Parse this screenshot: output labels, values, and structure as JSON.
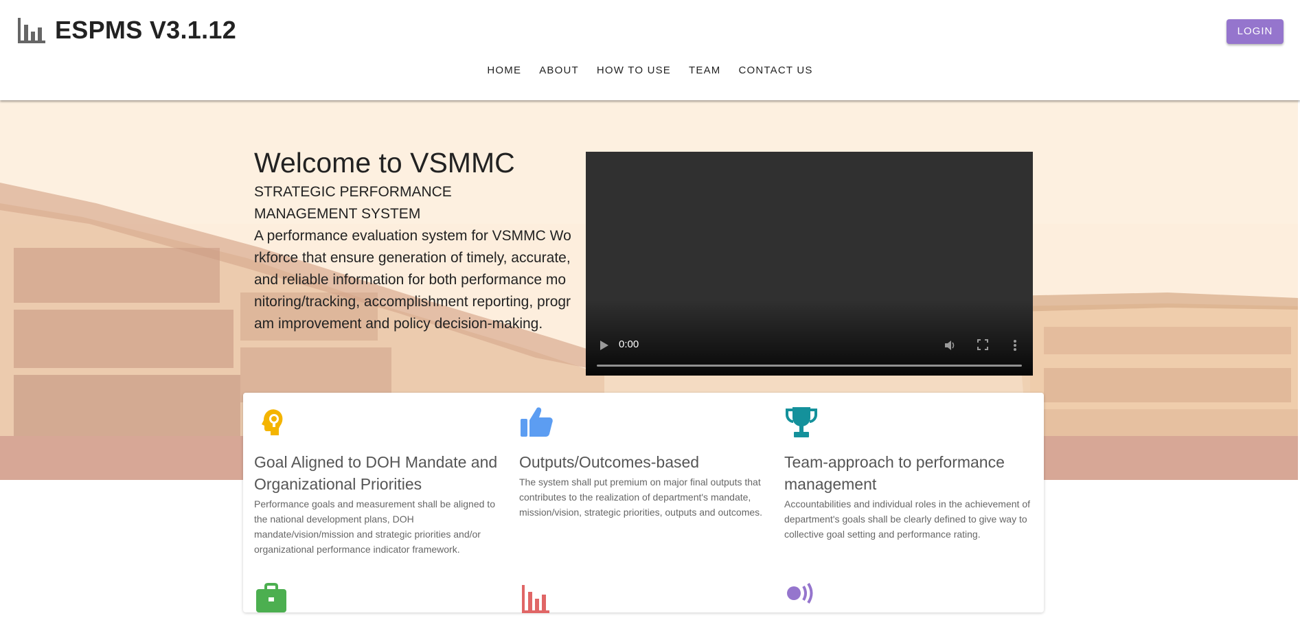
{
  "header": {
    "brand_icon": "bar-chart-icon",
    "title": "ESPMS V3.1.12",
    "login_label": "LOGIN",
    "nav": [
      {
        "label": "HOME"
      },
      {
        "label": "ABOUT"
      },
      {
        "label": "HOW TO USE"
      },
      {
        "label": "TEAM"
      },
      {
        "label": "CONTACT US"
      }
    ]
  },
  "hero": {
    "heading": "Welcome to VSMMC",
    "subtitle": "STRATEGIC PERFORMANCE MANAGEMENT SYSTEM",
    "description": "A performance evaluation system for VSMMC Workforce that ensure generation of timely, accurate, and reliable information for both performance monitoring/tracking, accomplishment reporting, program improvement and policy decision-making.",
    "video": {
      "time": "0:00"
    }
  },
  "features": [
    {
      "icon": "lightbulb-head-icon",
      "color": "#f4b400",
      "title": "Goal Aligned to DOH Mandate and Organizational Priorities",
      "text": "Performance goals and measurement shall be aligned to the national development plans, DOH mandate/vision/mission and strategic priorities and/or organizational performance indicator framework."
    },
    {
      "icon": "thumbs-up-icon",
      "color": "#5c9df2",
      "title": "Outputs/Outcomes-based",
      "text": "The system shall put premium on major final outputs that contributes to the realization of department's mandate, mission/vision, strategic priorities, outputs and outcomes."
    },
    {
      "icon": "trophy-icon",
      "color": "#14919b",
      "title": "Team-approach to performance management",
      "text": "Accountabilities and individual roles in the achievement of department's goals shall be clearly defined to give way to collective goal setting and performance rating."
    },
    {
      "icon": "briefcase-icon",
      "color": "#4caf50"
    },
    {
      "icon": "bar-chart-icon",
      "color": "#e06666"
    },
    {
      "icon": "broadcast-icon",
      "color": "#9575cd"
    }
  ],
  "colors": {
    "accent": "#9575cd",
    "hero_background": "#fdeedd"
  }
}
